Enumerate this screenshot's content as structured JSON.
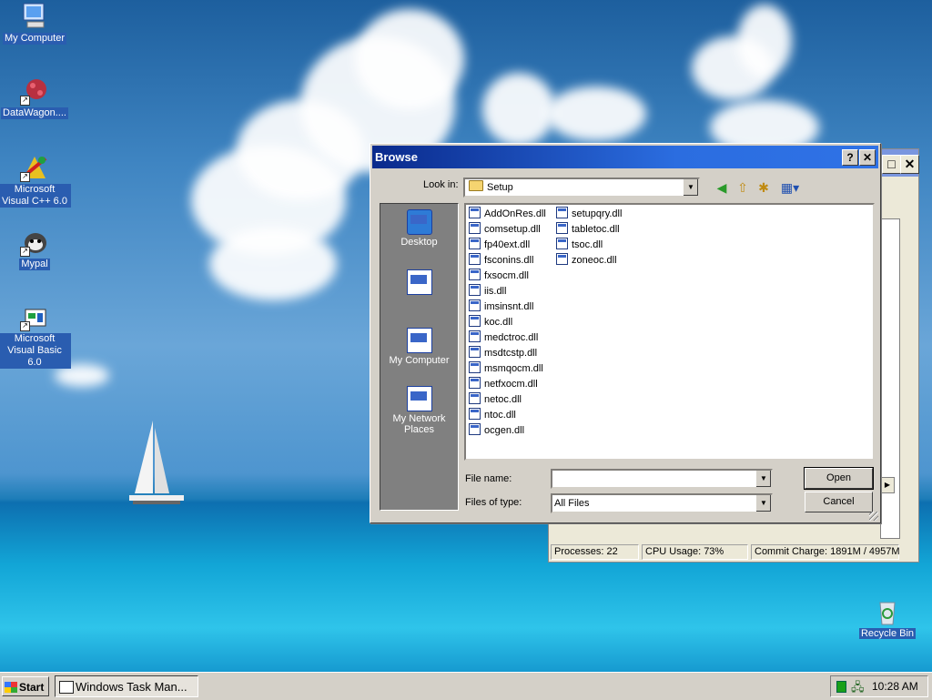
{
  "desktop_icons": [
    {
      "label": "My Computer",
      "icon": "my-computer-icon"
    },
    {
      "label": "DataWagon....",
      "icon": "datawagon-icon"
    },
    {
      "label": "Microsoft Visual C++ 6.0",
      "icon": "visual-cpp-icon"
    },
    {
      "label": "Mypal",
      "icon": "mypal-icon"
    },
    {
      "label": "Microsoft Visual Basic 6.0",
      "icon": "visual-basic-icon"
    },
    {
      "label": "Recycle Bin",
      "icon": "recycle-bin-icon"
    }
  ],
  "task_manager": {
    "status": {
      "processes": "Processes: 22",
      "cpu": "CPU Usage: 73%",
      "commit": "Commit Charge: 1891M / 4957M"
    }
  },
  "dialog": {
    "title": "Browse",
    "help_button": "?",
    "close_button": "✕",
    "look_in_label": "Look in:",
    "look_in_value": "Setup",
    "places": [
      {
        "label": "Desktop",
        "icon": "desktop-icon"
      },
      {
        "label": "",
        "icon": "my-documents-icon"
      },
      {
        "label": "My Computer",
        "icon": "my-computer-icon"
      },
      {
        "label": "My Network Places",
        "icon": "network-places-icon"
      }
    ],
    "files": [
      "AddOnRes.dll",
      "comsetup.dll",
      "fp40ext.dll",
      "fsconins.dll",
      "fxsocm.dll",
      "iis.dll",
      "imsinsnt.dll",
      "koc.dll",
      "medctroc.dll",
      "msdtcstp.dll",
      "msmqocm.dll",
      "netfxocm.dll",
      "netoc.dll",
      "ntoc.dll",
      "ocgen.dll",
      "setupqry.dll",
      "tabletoc.dll",
      "tsoc.dll",
      "zoneoc.dll"
    ],
    "file_name_label": "File name:",
    "file_name_value": "",
    "files_of_type_label": "Files of type:",
    "files_of_type_value": "All Files",
    "open_button": "Open",
    "cancel_button": "Cancel"
  },
  "taskbar": {
    "start_label": "Start",
    "task_label": "Windows Task Man...",
    "clock": "10:28 AM"
  }
}
